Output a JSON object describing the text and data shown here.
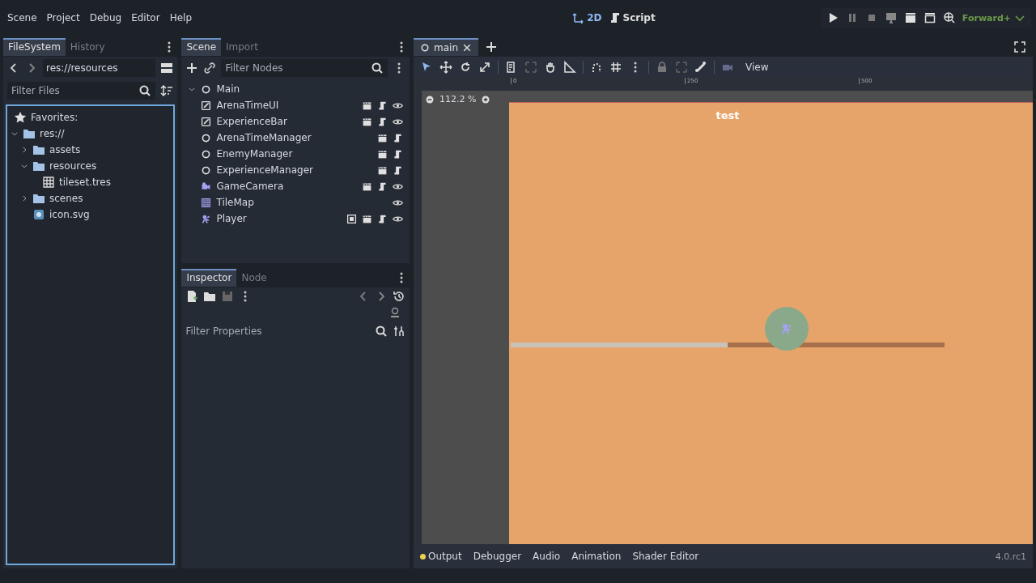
{
  "menu": [
    "Scene",
    "Project",
    "Debug",
    "Editor",
    "Help"
  ],
  "main_screens": [
    {
      "label": "2D",
      "kind": "axes",
      "selected": true
    },
    {
      "label": "Script",
      "kind": "script",
      "selected": false
    }
  ],
  "renderer": "Forward+",
  "filesystem": {
    "tabs": [
      {
        "label": "FileSystem",
        "selected": true
      },
      {
        "label": "History",
        "selected": false
      }
    ],
    "path": "res://resources",
    "filter": {
      "placeholder": "Filter Files"
    },
    "favorites": "Favorites:",
    "tree": [
      {
        "name": "res://",
        "kind": "folder",
        "expanded": true,
        "children": [
          {
            "name": "assets",
            "kind": "folder",
            "expanded": false
          },
          {
            "name": "resources",
            "kind": "folder",
            "expanded": true,
            "children": [
              {
                "name": "tileset.tres",
                "kind": "tileset"
              }
            ]
          },
          {
            "name": "scenes",
            "kind": "folder",
            "expanded": false
          },
          {
            "name": "icon.svg",
            "kind": "image"
          }
        ]
      }
    ]
  },
  "scene_dock": {
    "tabs": [
      {
        "label": "Scene",
        "selected": true
      },
      {
        "label": "Import",
        "selected": false
      }
    ],
    "filter": {
      "placeholder": "Filter Nodes"
    },
    "root": {
      "name": "Main",
      "kind": "node",
      "expanded": true,
      "children": [
        {
          "name": "ArenaTimeUI",
          "kind": "control",
          "instance": true,
          "script": true,
          "visible": true,
          "group": false
        },
        {
          "name": "ExperienceBar",
          "kind": "control",
          "instance": true,
          "script": true,
          "visible": true,
          "group": false
        },
        {
          "name": "ArenaTimeManager",
          "kind": "node",
          "instance": true,
          "script": true,
          "visible": false,
          "group": false
        },
        {
          "name": "EnemyManager",
          "kind": "node",
          "instance": true,
          "script": true,
          "visible": false,
          "group": false
        },
        {
          "name": "ExperienceManager",
          "kind": "node",
          "instance": true,
          "script": true,
          "visible": false,
          "group": false
        },
        {
          "name": "GameCamera",
          "kind": "camera",
          "instance": true,
          "script": true,
          "visible": true,
          "group": false
        },
        {
          "name": "TileMap",
          "kind": "tilemap",
          "instance": false,
          "script": false,
          "visible": true,
          "group": false
        },
        {
          "name": "Player",
          "kind": "player",
          "instance": true,
          "script": true,
          "visible": true,
          "group": true
        }
      ]
    }
  },
  "inspector": {
    "tabs": [
      {
        "label": "Inspector",
        "selected": true
      },
      {
        "label": "Node",
        "selected": false
      }
    ],
    "filter": {
      "placeholder": "Filter Properties"
    }
  },
  "editor": {
    "tabs": [
      {
        "label": "main",
        "selected": true
      }
    ],
    "view_menu": "View",
    "ruler_labels": [
      "0",
      "250",
      "500"
    ],
    "zoom": "112.2 %",
    "canvas": {
      "label": "test",
      "bar": {
        "level": 0.5
      }
    }
  },
  "bottom_panel": {
    "tabs": [
      {
        "label": "Output",
        "kind": "output"
      },
      {
        "label": "Debugger",
        "kind": "plain"
      },
      {
        "label": "Audio",
        "kind": "plain"
      },
      {
        "label": "Animation",
        "kind": "plain"
      },
      {
        "label": "Shader Editor",
        "kind": "plain"
      }
    ],
    "version": "4.0.rc1"
  }
}
